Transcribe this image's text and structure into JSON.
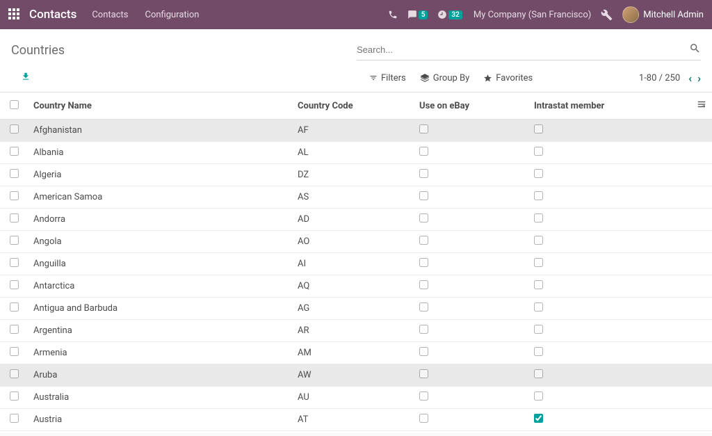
{
  "header": {
    "brand": "Contacts",
    "nav": [
      "Contacts",
      "Configuration"
    ],
    "msg_badge": "5",
    "activity_badge": "32",
    "company": "My Company (San Francisco)",
    "user": "Mitchell Admin"
  },
  "breadcrumb": "Countries",
  "search": {
    "placeholder": "Search..."
  },
  "filters": {
    "filters": "Filters",
    "groupby": "Group By",
    "favorites": "Favorites"
  },
  "pager": {
    "range": "1-80 / 250"
  },
  "columns": {
    "name": "Country Name",
    "code": "Country Code",
    "ebay": "Use on eBay",
    "intrastat": "Intrastat member"
  },
  "rows": [
    {
      "name": "Afghanistan",
      "code": "AF",
      "ebay": false,
      "intrastat": false,
      "hovered": true
    },
    {
      "name": "Albania",
      "code": "AL",
      "ebay": false,
      "intrastat": false
    },
    {
      "name": "Algeria",
      "code": "DZ",
      "ebay": false,
      "intrastat": false
    },
    {
      "name": "American Samoa",
      "code": "AS",
      "ebay": false,
      "intrastat": false
    },
    {
      "name": "Andorra",
      "code": "AD",
      "ebay": false,
      "intrastat": false
    },
    {
      "name": "Angola",
      "code": "AO",
      "ebay": false,
      "intrastat": false
    },
    {
      "name": "Anguilla",
      "code": "AI",
      "ebay": false,
      "intrastat": false
    },
    {
      "name": "Antarctica",
      "code": "AQ",
      "ebay": false,
      "intrastat": false
    },
    {
      "name": "Antigua and Barbuda",
      "code": "AG",
      "ebay": false,
      "intrastat": false
    },
    {
      "name": "Argentina",
      "code": "AR",
      "ebay": false,
      "intrastat": false
    },
    {
      "name": "Armenia",
      "code": "AM",
      "ebay": false,
      "intrastat": false
    },
    {
      "name": "Aruba",
      "code": "AW",
      "ebay": false,
      "intrastat": false,
      "hovered": true
    },
    {
      "name": "Australia",
      "code": "AU",
      "ebay": false,
      "intrastat": false
    },
    {
      "name": "Austria",
      "code": "AT",
      "ebay": false,
      "intrastat": true
    }
  ]
}
